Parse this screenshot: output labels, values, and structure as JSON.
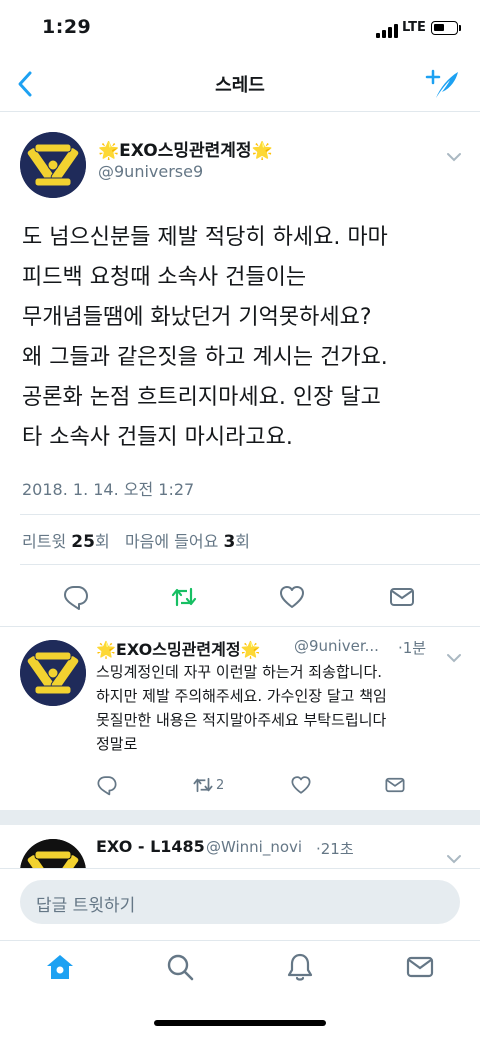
{
  "status_bar": {
    "time": "1:29",
    "network": "LTE"
  },
  "nav": {
    "title": "스레드"
  },
  "tweet": {
    "display_name": "🌟EXO스밍관련계정🌟",
    "handle": "@9universe9",
    "text_lines": [
      "도 넘으신분들 제발 적당히 하세요. 마마",
      "피드백 요청때 소속사 건들이는",
      "무개념들땜에 화났던거 기억못하세요?",
      "왜 그들과 같은짓을 하고 계시는 건가요.",
      "공론화 논점 흐트리지마세요. 인장 달고",
      "타 소속사 건들지 마시라고요."
    ],
    "timestamp": "2018. 1. 14. 오전 1:27",
    "retweets_label": "리트윗",
    "retweets_count": "25",
    "retweets_unit": "회",
    "likes_label": "마음에 들어요",
    "likes_count": "3",
    "likes_unit": "회"
  },
  "reply": {
    "display_name": "🌟EXO스밍관련계정🌟",
    "handle": "@9univer...",
    "time": "·1분",
    "text_lines": [
      "스밍계정인데 자꾸 이런말 하는거 죄송합니다.",
      "하지만 제발 주의해주세요. 가수인장 달고 책임",
      "못질만한 내용은 적지말아주세요 부탁드립니다",
      "정말로"
    ],
    "retweet_count": "2"
  },
  "reply2": {
    "display_name": "EXO - L1485",
    "handle": "@Winni_novi",
    "time": "·21초"
  },
  "composer": {
    "placeholder": "답글 트윗하기"
  },
  "colors": {
    "accent": "#1da1f2",
    "retweet_active": "#17bf63",
    "muted": "#657786"
  },
  "icons": [
    "back-icon",
    "compose-icon",
    "chevron-down-icon",
    "reply-icon",
    "retweet-icon",
    "like-icon",
    "dm-icon",
    "home-icon",
    "search-icon",
    "notifications-icon",
    "messages-icon"
  ]
}
